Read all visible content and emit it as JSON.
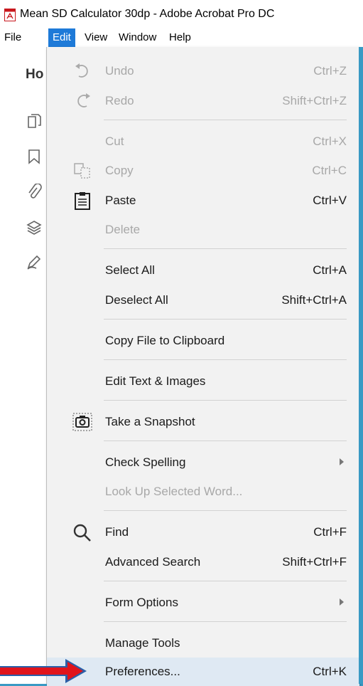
{
  "window": {
    "title": "Mean SD Calculator 30dp - Adobe Acrobat Pro DC"
  },
  "menubar": {
    "items": [
      {
        "label": "File"
      },
      {
        "label": "Edit"
      },
      {
        "label": "View"
      },
      {
        "label": "Window"
      },
      {
        "label": "Help"
      }
    ]
  },
  "left_panel": {
    "home_tab": "Ho"
  },
  "edit_menu": {
    "items": [
      {
        "label": "Undo",
        "shortcut": "Ctrl+Z",
        "enabled": false,
        "icon": "undo-icon"
      },
      {
        "label": "Redo",
        "shortcut": "Shift+Ctrl+Z",
        "enabled": false,
        "icon": "redo-icon"
      },
      {
        "label": "Cut",
        "shortcut": "Ctrl+X",
        "enabled": false
      },
      {
        "label": "Copy",
        "shortcut": "Ctrl+C",
        "enabled": false,
        "icon": "copy-icon"
      },
      {
        "label": "Paste",
        "shortcut": "Ctrl+V",
        "enabled": true,
        "icon": "paste-icon"
      },
      {
        "label": "Delete",
        "shortcut": "",
        "enabled": false
      },
      {
        "label": "Select All",
        "shortcut": "Ctrl+A",
        "enabled": true
      },
      {
        "label": "Deselect All",
        "shortcut": "Shift+Ctrl+A",
        "enabled": true
      },
      {
        "label": "Copy File to Clipboard",
        "shortcut": "",
        "enabled": true
      },
      {
        "label": "Edit Text & Images",
        "shortcut": "",
        "enabled": true
      },
      {
        "label": "Take a Snapshot",
        "shortcut": "",
        "enabled": true,
        "icon": "camera-icon"
      },
      {
        "label": "Check Spelling",
        "shortcut": "",
        "enabled": true,
        "submenu": true
      },
      {
        "label": "Look Up Selected Word...",
        "shortcut": "",
        "enabled": false
      },
      {
        "label": "Find",
        "shortcut": "Ctrl+F",
        "enabled": true,
        "icon": "search-icon"
      },
      {
        "label": "Advanced Search",
        "shortcut": "Shift+Ctrl+F",
        "enabled": true
      },
      {
        "label": "Form Options",
        "shortcut": "",
        "enabled": true,
        "submenu": true
      },
      {
        "label": "Manage Tools",
        "shortcut": "",
        "enabled": true
      },
      {
        "label": "Preferences...",
        "shortcut": "Ctrl+K",
        "enabled": true,
        "highlighted": true
      }
    ]
  },
  "colors": {
    "menu_active": "#1e7ad8",
    "highlight": "#dfe9f3",
    "pointer_red": "#e0141b",
    "pointer_blue": "#2a5fa8",
    "frame": "#3a9ac4"
  }
}
